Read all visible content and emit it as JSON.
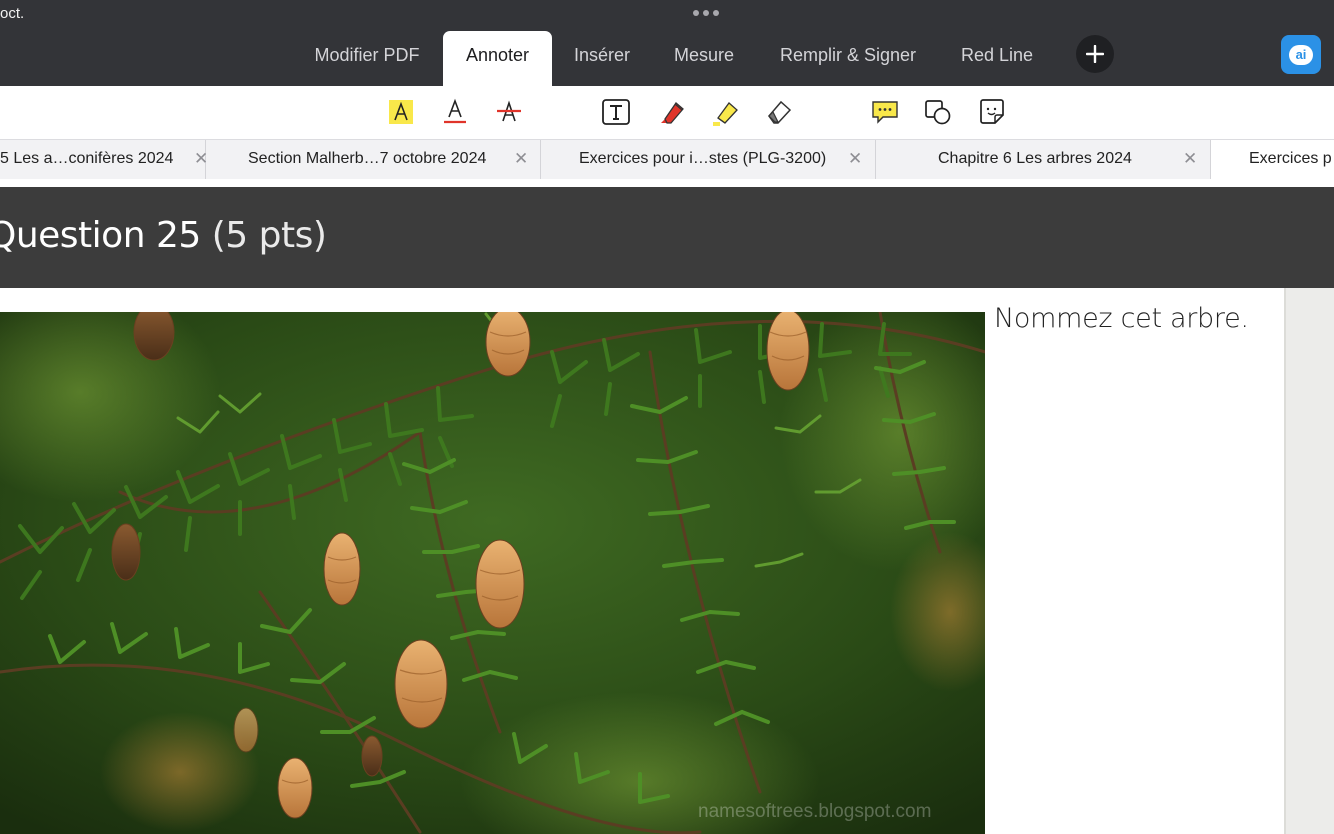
{
  "status": {
    "time_fragment": "oct."
  },
  "menu_tabs": [
    {
      "label": "Modifier PDF",
      "active": false
    },
    {
      "label": "Annoter",
      "active": true
    },
    {
      "label": "Insérer",
      "active": false
    },
    {
      "label": "Mesure",
      "active": false
    },
    {
      "label": "Remplir & Signer",
      "active": false
    },
    {
      "label": "Red Line",
      "active": false
    }
  ],
  "ai_button": {
    "label": "ai"
  },
  "tools": [
    "text-highlight-icon",
    "text-underline-icon",
    "text-strikethrough-icon",
    "text-box-icon",
    "pen-icon",
    "highlighter-icon",
    "eraser-icon",
    "comment-icon",
    "shapes-icon",
    "sticky-note-icon"
  ],
  "document_tabs": [
    {
      "label": "5 Les a…conifères 2024",
      "active": false
    },
    {
      "label": "Section Malherb…7 octobre 2024",
      "active": false
    },
    {
      "label": "Exercices pour i…stes (PLG-3200)",
      "active": false
    },
    {
      "label": "Chapitre 6 Les arbres  2024",
      "active": false
    },
    {
      "label": "Exercices p",
      "active": true
    }
  ],
  "question": {
    "title": "Question 25",
    "points": "(5 pts)",
    "prompt": "Nommez cet arbre."
  },
  "photo": {
    "watermark": "namesoftrees.blogspot.com"
  },
  "colors": {
    "topbar": "#333438",
    "question_bar": "#3c3c3c",
    "accent_blue": "#2b91e6",
    "highlight_yellow": "#f9e84a",
    "underline_red": "#e0342a"
  }
}
